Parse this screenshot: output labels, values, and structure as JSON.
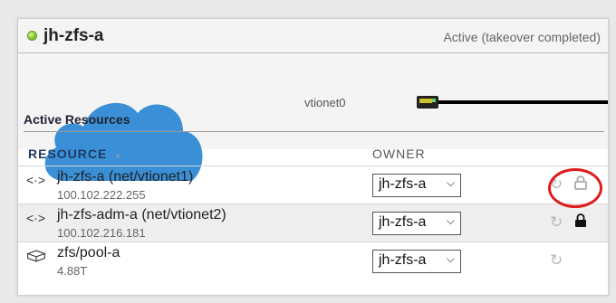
{
  "node": {
    "name": "jh-zfs-a",
    "status": "Active (takeover completed)",
    "status_color": "#6cbf1c"
  },
  "network": {
    "interface_label": "vtionet0",
    "icon": "ethernet-port-icon"
  },
  "section": {
    "title": "Active Resources"
  },
  "table": {
    "columns": {
      "resource": "RESOURCE",
      "sort_indicator": "▲",
      "owner": "OWNER"
    },
    "rows": [
      {
        "icon": "network-link-icon",
        "icon_glyph": "<·>",
        "name": "jh-zfs-a (net/vtionet1)",
        "detail": "100.102.222.255",
        "owner": "jh-zfs-a",
        "lock": "unlocked"
      },
      {
        "icon": "network-link-icon",
        "icon_glyph": "<·>",
        "name": "jh-zfs-adm-a (net/vtionet2)",
        "detail": "100.102.216.181",
        "owner": "jh-zfs-a",
        "lock": "locked"
      },
      {
        "icon": "storage-pool-icon",
        "icon_glyph": "",
        "name": "zfs/pool-a",
        "detail": "4.88T",
        "owner": "jh-zfs-a",
        "lock": "none"
      }
    ]
  },
  "colors": {
    "accent_cloud": "#3a8fd6",
    "highlight": "#e01b1b",
    "header_text": "#1f3b63"
  }
}
